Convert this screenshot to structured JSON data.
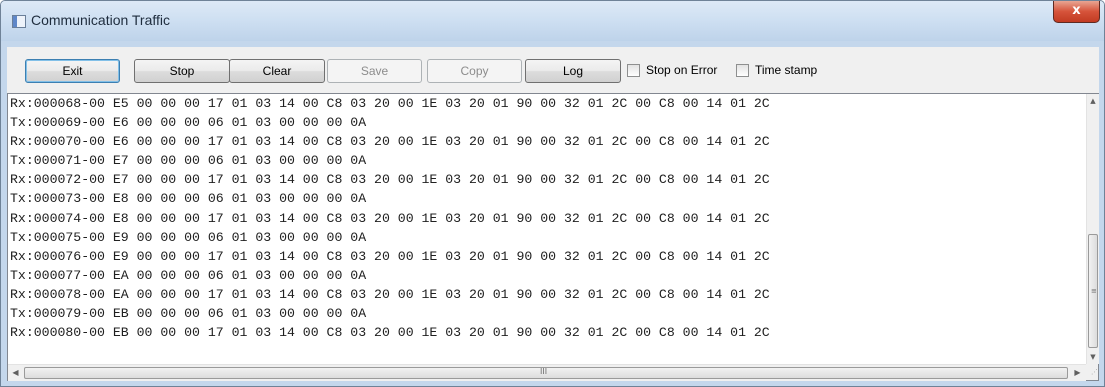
{
  "window": {
    "title": "Communication Traffic",
    "close_label": "x"
  },
  "toolbar": {
    "exit_label": "Exit",
    "stop_label": "Stop",
    "clear_label": "Clear",
    "save_label": "Save",
    "copy_label": "Copy",
    "log_label": "Log",
    "stop_on_error_label": "Stop on Error",
    "stop_on_error_checked": false,
    "time_stamp_label": "Time stamp",
    "time_stamp_checked": false
  },
  "log": {
    "lines": [
      "Rx:000068-00 E5 00 00 00 17 01 03 14 00 C8 03 20 00 1E 03 20 01 90 00 32 01 2C 00 C8 00 14 01 2C",
      "Tx:000069-00 E6 00 00 00 06 01 03 00 00 00 0A",
      "Rx:000070-00 E6 00 00 00 17 01 03 14 00 C8 03 20 00 1E 03 20 01 90 00 32 01 2C 00 C8 00 14 01 2C",
      "Tx:000071-00 E7 00 00 00 06 01 03 00 00 00 0A",
      "Rx:000072-00 E7 00 00 00 17 01 03 14 00 C8 03 20 00 1E 03 20 01 90 00 32 01 2C 00 C8 00 14 01 2C",
      "Tx:000073-00 E8 00 00 00 06 01 03 00 00 00 0A",
      "Rx:000074-00 E8 00 00 00 17 01 03 14 00 C8 03 20 00 1E 03 20 01 90 00 32 01 2C 00 C8 00 14 01 2C",
      "Tx:000075-00 E9 00 00 00 06 01 03 00 00 00 0A",
      "Rx:000076-00 E9 00 00 00 17 01 03 14 00 C8 03 20 00 1E 03 20 01 90 00 32 01 2C 00 C8 00 14 01 2C",
      "Tx:000077-00 EA 00 00 00 06 01 03 00 00 00 0A",
      "Rx:000078-00 EA 00 00 00 17 01 03 14 00 C8 03 20 00 1E 03 20 01 90 00 32 01 2C 00 C8 00 14 01 2C",
      "Tx:000079-00 EB 00 00 00 06 01 03 00 00 00 0A",
      "Rx:000080-00 EB 00 00 00 17 01 03 14 00 C8 03 20 00 1E 03 20 01 90 00 32 01 2C 00 C8 00 14 01 2C"
    ]
  },
  "scrollbars": {
    "up_arrow": "▲",
    "down_arrow": "▼",
    "left_arrow": "◀",
    "right_arrow": "▶",
    "h_grip": "III"
  }
}
